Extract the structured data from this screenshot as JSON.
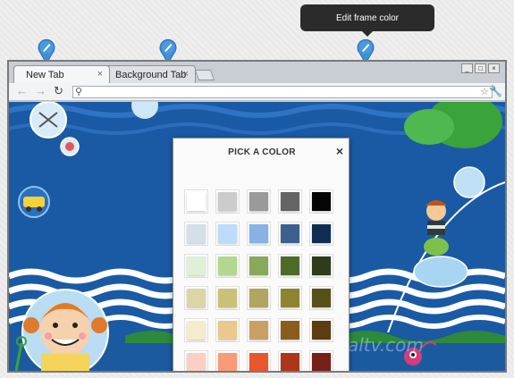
{
  "tooltip": {
    "text": "Edit frame color"
  },
  "pins": {
    "icon": "paintbrush-pin-icon",
    "color": "#3f8fd4"
  },
  "tabs": [
    {
      "label": "New Tab",
      "close": "×"
    },
    {
      "label": "Background Tab",
      "close": "×"
    }
  ],
  "window_controls": {
    "minimize": "_",
    "maximize": "□",
    "close": "×"
  },
  "toolbar": {
    "back": "←",
    "forward": "→",
    "reload": "↻",
    "search_icon": "⚲",
    "star": "☆",
    "wrench": "🔧",
    "address_value": ""
  },
  "watermark": "nirmaltv.com",
  "dialog": {
    "title": "PICK A COLOR",
    "close": "×",
    "swatches": [
      [
        "#ffffff",
        "#cccccc",
        "#9a9a9a",
        "#646464",
        "#050505"
      ],
      [
        "#d4dfe8",
        "#bcdcf9",
        "#86b2e6",
        "#3c5f8e",
        "#0f2d52"
      ],
      [
        "#dff0d6",
        "#b2d88f",
        "#86aa59",
        "#4c6b27",
        "#2f3c1c"
      ],
      [
        "#dcd6a6",
        "#c8c177",
        "#b0a65f",
        "#8e842f",
        "#575018"
      ],
      [
        "#f5ebcd",
        "#e9c98c",
        "#c9a063",
        "#8c5c1c",
        "#5c3c10"
      ],
      [
        "#fbd0c0",
        "#f99a78",
        "#e8562b",
        "#ad361a",
        "#762017"
      ]
    ]
  }
}
